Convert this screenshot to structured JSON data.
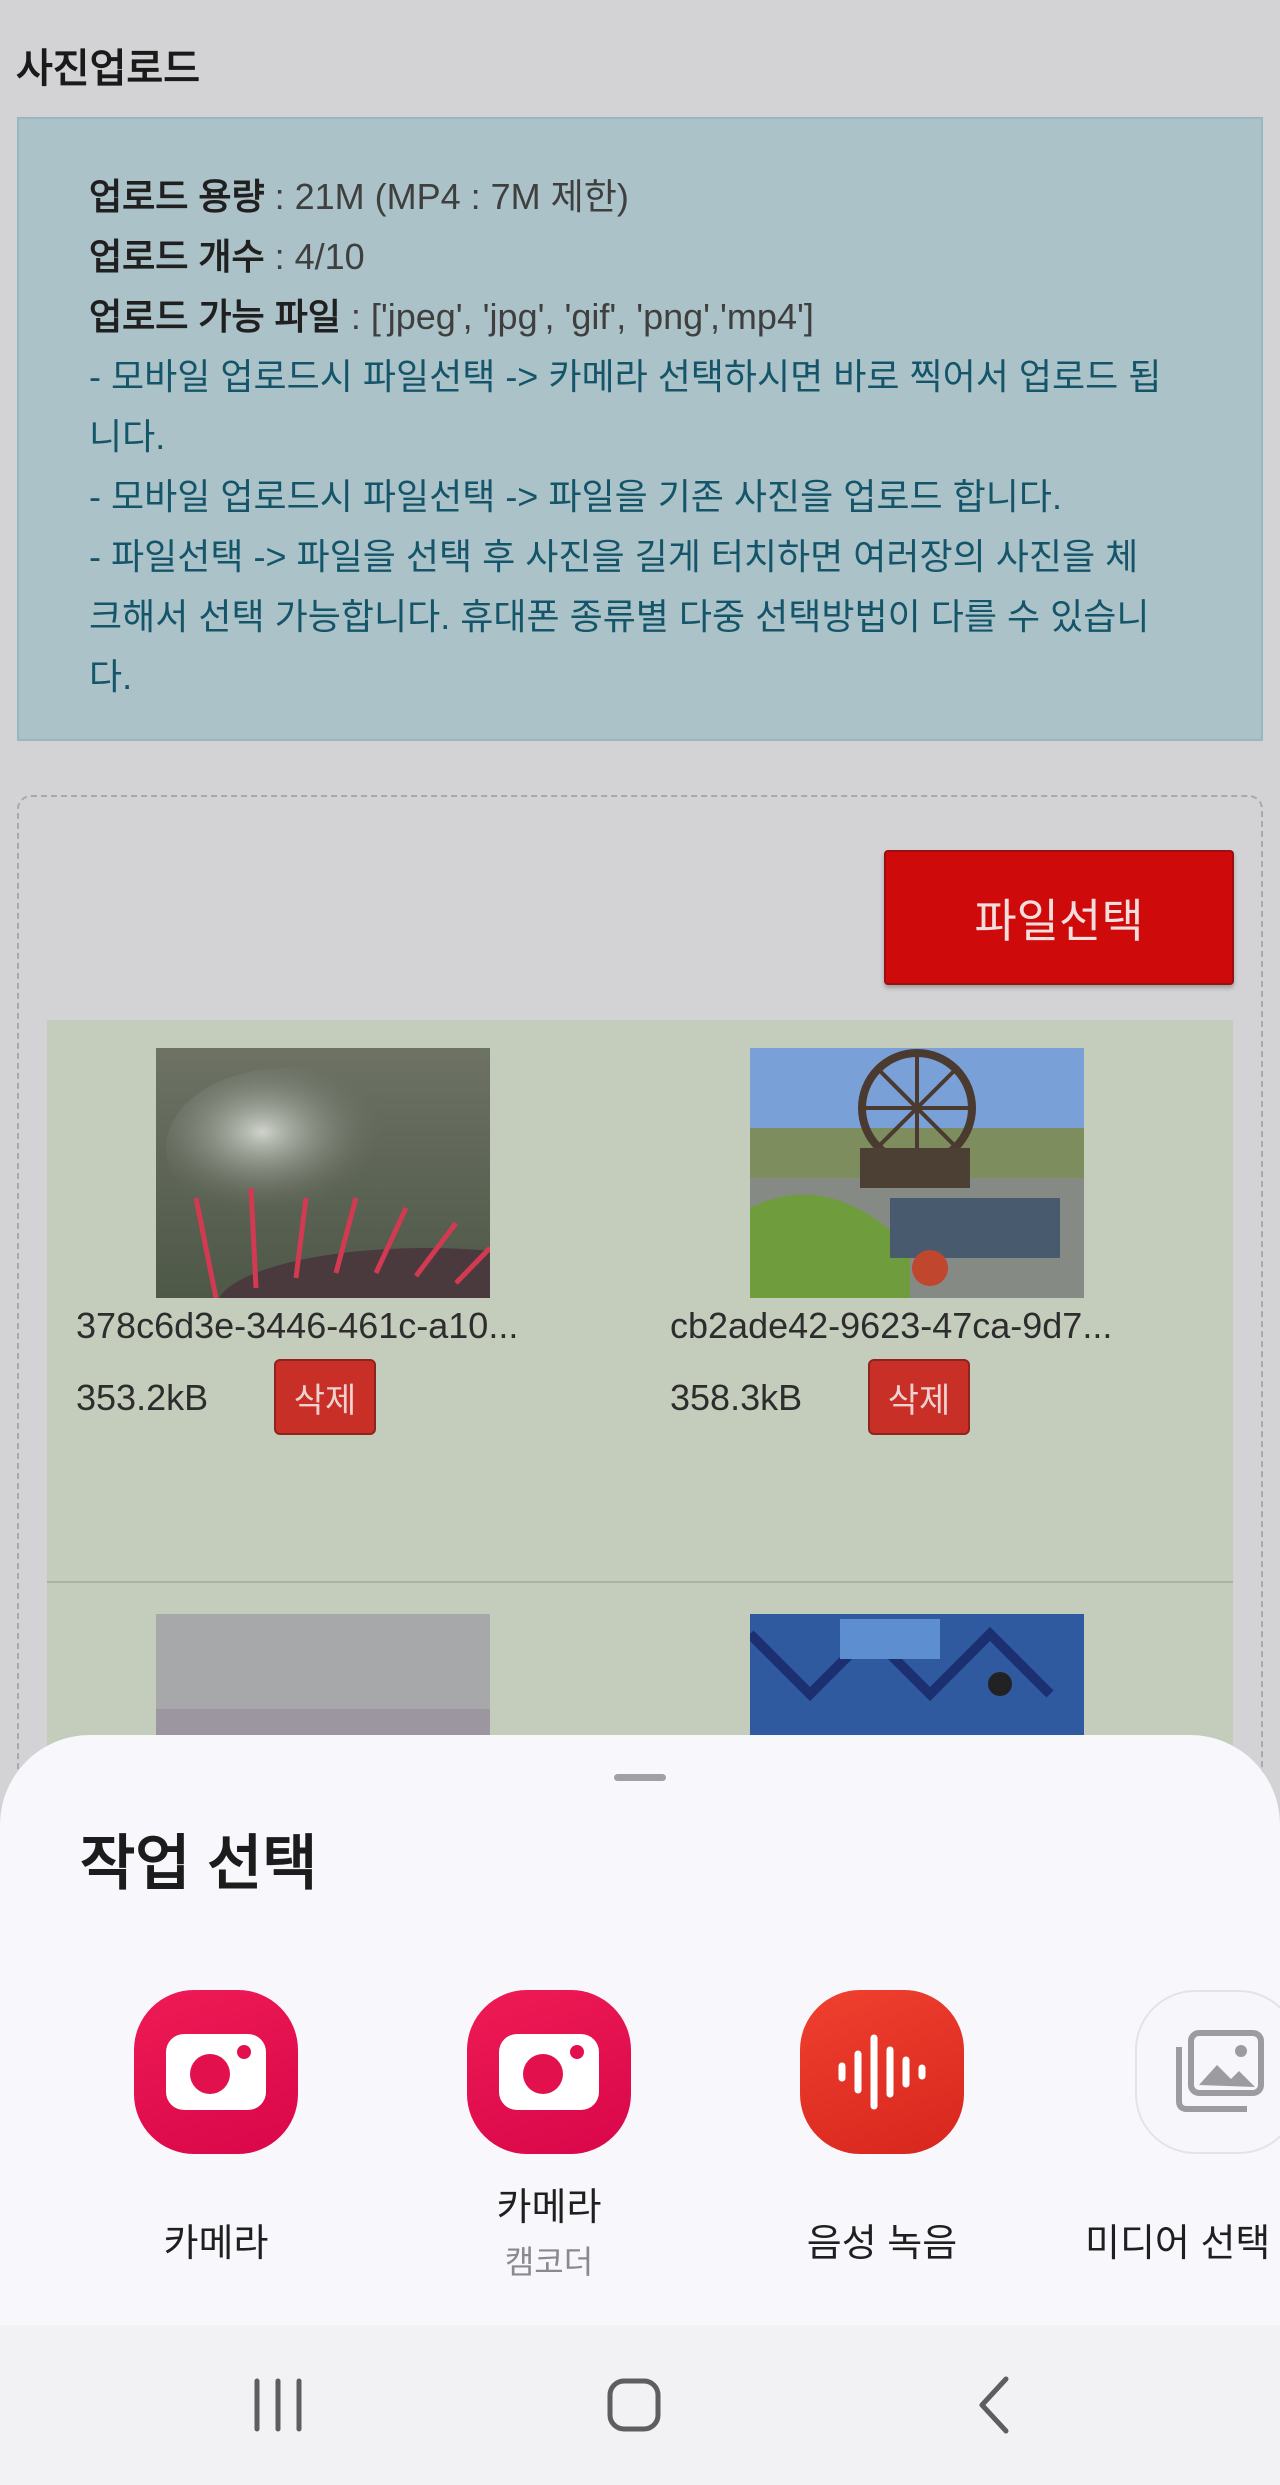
{
  "page": {
    "title": "사진업로드"
  },
  "info": {
    "capacity_label": "업로드 용량",
    "capacity_value": " : 21M (MP4 : 7M 제한)",
    "count_label": "업로드 개수",
    "count_value": " : 4/10",
    "types_label": "업로드 가능 파일",
    "types_value": " : ['jpeg', 'jpg', 'gif', 'png','mp4']",
    "note1_line1": "- 모바일 업로드시 파일선택 -> 카메라 선택하시면 바로 찍어서 업로드 됩",
    "note1_line2": "니다.",
    "note2": "- 모바일 업로드시 파일선택 -> 파일을 기존 사진을 업로드 합니다.",
    "note3_line1": "- 파일선택 -> 파일을 선택 후 사진을 길게 터치하면 여러장의 사진을 체",
    "note3_line2": "크해서 선택 가능합니다. 휴대폰 종류별 다중 선택방법이 다를 수 있습니",
    "note3_line3": "다."
  },
  "upload": {
    "file_select_label": "파일선택",
    "delete_label": "삭제",
    "files": [
      {
        "name": "378c6d3e-3446-461c-a10...",
        "size": "353.2kB"
      },
      {
        "name": "cb2ade42-9623-47ca-9d7...",
        "size": "358.3kB"
      }
    ]
  },
  "sheet": {
    "title": "작업 선택",
    "apps": [
      {
        "label": "카메라",
        "sub": "",
        "icon": "camera-icon"
      },
      {
        "label": "카메라",
        "sub": "캠코더",
        "icon": "camcorder-icon"
      },
      {
        "label": "음성 녹음",
        "sub": "",
        "icon": "voice-recorder-icon"
      },
      {
        "label": "미디어 선택",
        "sub": "",
        "icon": "media-picker-icon"
      }
    ]
  },
  "colors": {
    "accent_red": "#cf0a0a",
    "info_bg": "#aac2c8",
    "camera_pink": "#e5104f",
    "recorder_red": "#e3311f"
  }
}
